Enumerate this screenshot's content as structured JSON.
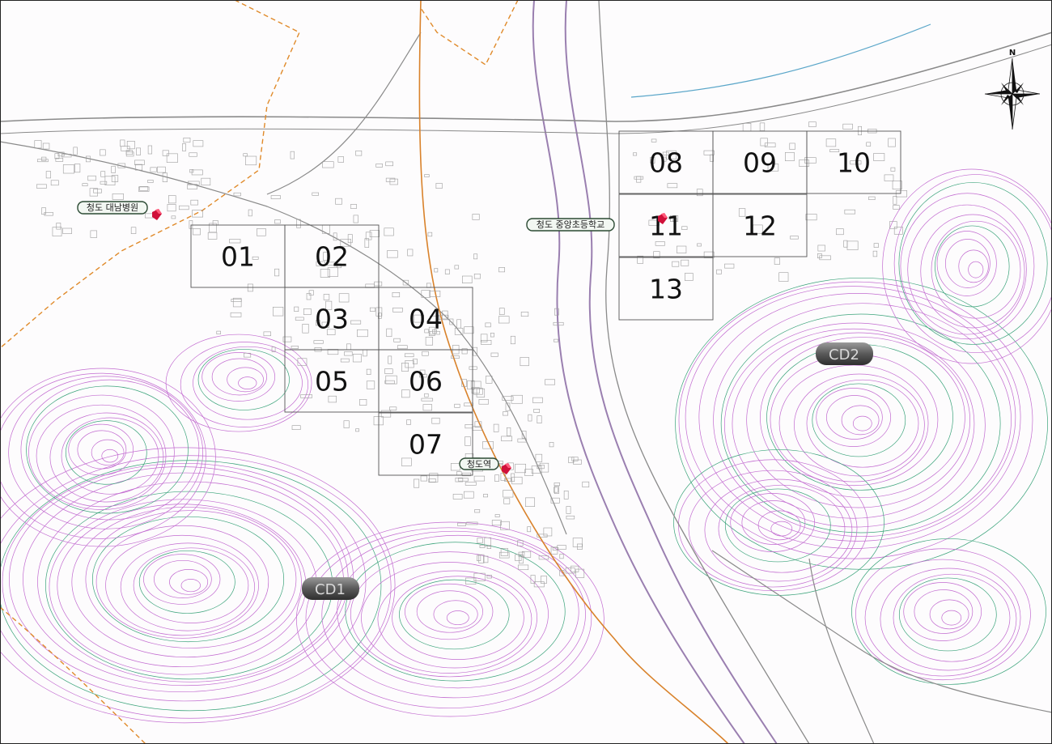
{
  "map": {
    "grid_cells": [
      {
        "id": "01"
      },
      {
        "id": "02"
      },
      {
        "id": "03"
      },
      {
        "id": "04"
      },
      {
        "id": "05"
      },
      {
        "id": "06"
      },
      {
        "id": "07"
      },
      {
        "id": "08"
      },
      {
        "id": "09"
      },
      {
        "id": "10"
      },
      {
        "id": "11"
      },
      {
        "id": "12"
      },
      {
        "id": "13"
      }
    ],
    "places": [
      {
        "name": "청도 대남병원"
      },
      {
        "name": "청도 중앙초등학교"
      },
      {
        "name": "청도역"
      }
    ],
    "badges": [
      {
        "label": "CD1"
      },
      {
        "label": "CD2"
      }
    ],
    "compass": {
      "north_label": "N"
    },
    "colors": {
      "contour": "#c26bd0",
      "contour_green": "#3aa37a",
      "road": "#8a8a8a",
      "boundary": "#e08a2a",
      "rail": "#d9822b",
      "marker": "#d0103a",
      "grid_line": "#555555"
    }
  }
}
